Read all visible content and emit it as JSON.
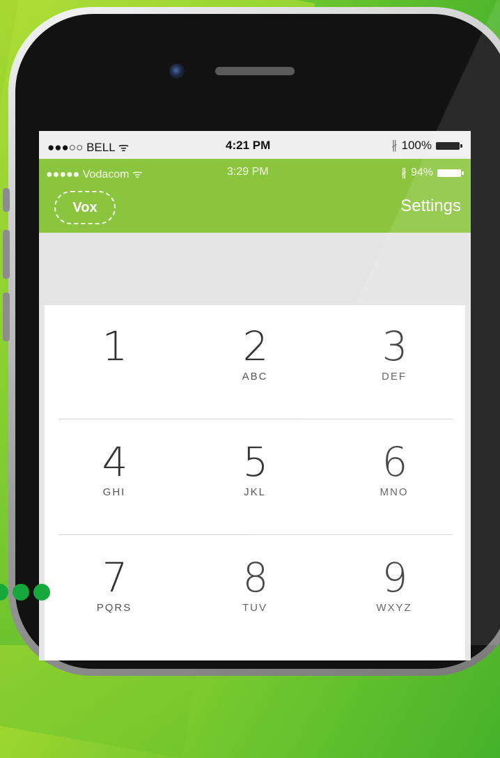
{
  "outer_status_bar": {
    "carrier": "●●●○○ BELL",
    "wifi_glyph": "ᯤ",
    "time": "4:21 PM",
    "bluetooth_glyph": "∦",
    "battery": "100%"
  },
  "inner_status_bar": {
    "carrier": "●●●●● Vodacom",
    "wifi_glyph": "ᯤ",
    "time": "3:29 PM",
    "bluetooth_glyph": "∦",
    "battery": "94%"
  },
  "header": {
    "vox_label": "Vox",
    "settings_label": "Settings",
    "accent_color": "#8bc540"
  },
  "keypad": {
    "rows": [
      [
        {
          "digit": "1",
          "letters": ""
        },
        {
          "digit": "2",
          "letters": "ABC"
        },
        {
          "digit": "3",
          "letters": "DEF"
        }
      ],
      [
        {
          "digit": "4",
          "letters": "GHI"
        },
        {
          "digit": "5",
          "letters": "JKL"
        },
        {
          "digit": "6",
          "letters": "MNO"
        }
      ],
      [
        {
          "digit": "7",
          "letters": "PQRS"
        },
        {
          "digit": "8",
          "letters": "TUV"
        },
        {
          "digit": "9",
          "letters": "WXYZ"
        }
      ]
    ]
  }
}
